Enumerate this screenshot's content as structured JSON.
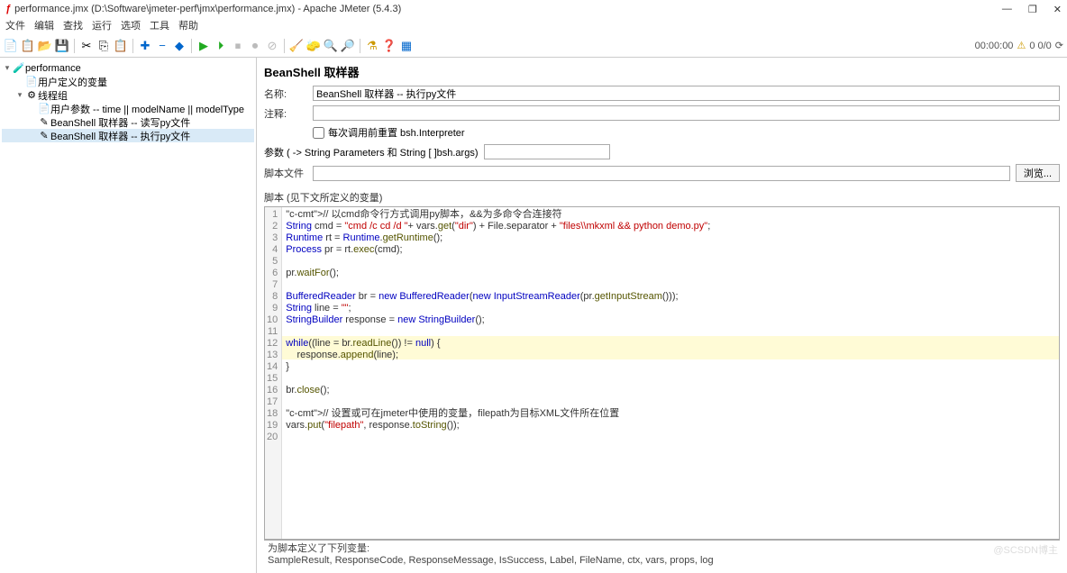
{
  "window": {
    "title": "performance.jmx (D:\\Software\\jmeter-perf\\jmx\\performance.jmx) - Apache JMeter (5.4.3)",
    "minimize": "—",
    "maximize": "❐",
    "close": "✕"
  },
  "menu": [
    "文件",
    "编辑",
    "查找",
    "运行",
    "选项",
    "工具",
    "帮助"
  ],
  "status": {
    "time": "00:00:00",
    "warn": "⚠",
    "err": "0  0/0",
    "gear": "⟳"
  },
  "tree": {
    "root": "performance",
    "items": [
      {
        "icon": "📄",
        "label": "用户定义的变量",
        "indent": 1
      },
      {
        "icon": "⚙",
        "label": "线程组",
        "indent": 1,
        "twisty": "▾"
      },
      {
        "icon": "📄",
        "label": "用户参数 -- time || modelName || modelType",
        "indent": 2
      },
      {
        "icon": "✎",
        "label": "BeanShell 取样器 -- 读写py文件",
        "indent": 2
      },
      {
        "icon": "✎",
        "label": "BeanShell 取样器 -- 执行py文件",
        "indent": 2,
        "sel": true
      }
    ]
  },
  "panel": {
    "title": "BeanShell 取样器",
    "name_lbl": "名称:",
    "name": "BeanShell 取样器 -- 执行py文件",
    "comment_lbl": "注释:",
    "comment": "",
    "cb_label": "每次调用前重置 bsh.Interpreter",
    "params_lbl": "参数 ( -> String Parameters 和 String [ ]bsh.args)",
    "file_lbl": "脚本文件",
    "file": "",
    "browse": "浏览...",
    "script_lbl": "脚本 (见下文所定义的变量)"
  },
  "code": {
    "lines": [
      "// 以cmd命令行方式调用py脚本，&&为多命令合连接符",
      "String cmd = \"cmd /c cd /d \"+ vars.get(\"dir\") + File.separator + \"files\\\\mkxml && python demo.py\";",
      "Runtime rt = Runtime.getRuntime();",
      "Process pr = rt.exec(cmd);",
      "",
      "pr.waitFor();",
      "",
      "BufferedReader br = new BufferedReader(new InputStreamReader(pr.getInputStream()));",
      "String line = \"\";",
      "StringBuilder response = new StringBuilder();",
      "",
      "while((line = br.readLine()) != null) {",
      "    response.append(line);",
      "}",
      "",
      "br.close();",
      "",
      "// 设置或可在jmeter中使用的变量，filepath为目标XML文件所在位置",
      "vars.put(\"filepath\", response.toString());",
      ""
    ]
  },
  "footer": {
    "l1": "为脚本定义了下列变量:",
    "l2": "SampleResult, ResponseCode, ResponseMessage, IsSuccess, Label, FileName, ctx, vars, props, log"
  },
  "watermark": "@SCSDN博主"
}
